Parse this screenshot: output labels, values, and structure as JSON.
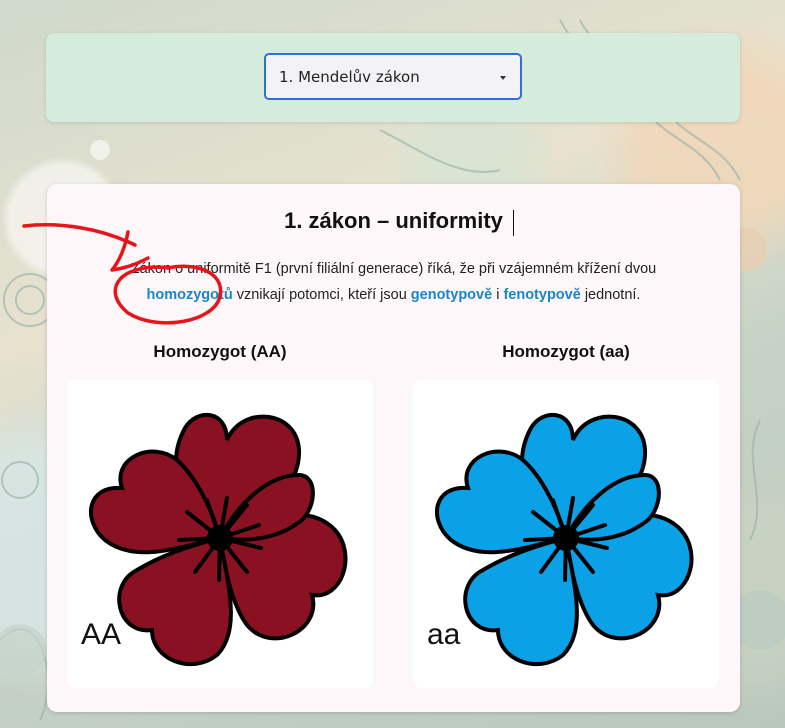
{
  "selector": {
    "value": "1. Mendelův zákon"
  },
  "section": {
    "title": "1. zákon – uniformity",
    "paragraph": {
      "part1": "Zákon o uniformitě F1 (první filiální generace) říká, že při vzájemném křížení dvou ",
      "term1": "homozygotů",
      "part2": " vznikají potomci, kteří jsou ",
      "term2": "genotypově",
      "part3": " i ",
      "term3": "fenotypově",
      "part4": " jednotní."
    },
    "columns": [
      {
        "title": "Homozygot (AA)",
        "label": "AA",
        "flower_color": "#8a1122",
        "icon": "flower-image"
      },
      {
        "title": "Homozygot (aa)",
        "label": "aa",
        "flower_color": "#0aa1e6",
        "icon": "flower-image"
      }
    ]
  },
  "colors": {
    "accent": "#1a86c9",
    "annotation": "#e8131b"
  }
}
